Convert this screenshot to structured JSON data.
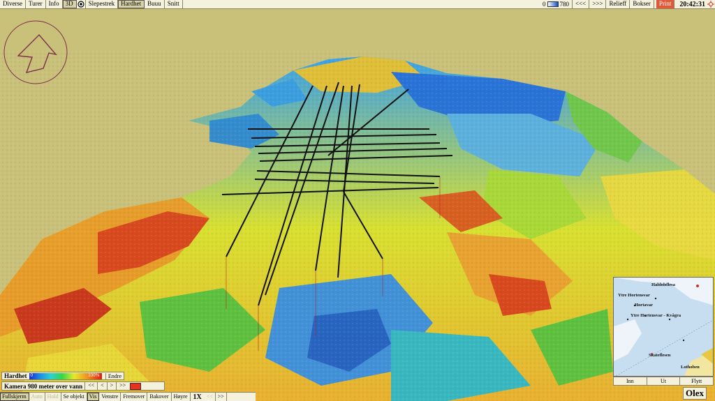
{
  "menu": {
    "items": [
      {
        "label": "Diverse",
        "active": false
      },
      {
        "label": "Turer",
        "active": false
      },
      {
        "label": "Info",
        "active": false
      },
      {
        "label": "3D",
        "active": true
      }
    ],
    "items2": [
      {
        "label": "Slepestrek",
        "active": false
      },
      {
        "label": "Hardhet",
        "active": true
      },
      {
        "label": "Buuu",
        "active": false
      },
      {
        "label": "Snitt",
        "active": false
      }
    ]
  },
  "depth": {
    "min": "0",
    "max": "780",
    "prev": "<<<",
    "next": ">>>"
  },
  "right_menu": {
    "relief": "Relieff",
    "bokser": "Bokser",
    "print": "Print"
  },
  "clock": "20:42:31",
  "hardness": {
    "label": "Hardhet",
    "min": "0",
    "max": "100%",
    "edit": "Endre"
  },
  "camera": {
    "label": "Kamera 980 meter over vann",
    "b1": "<<",
    "b2": "<",
    "b3": ">",
    "b4": ">>"
  },
  "bottom": {
    "items": [
      {
        "label": "Fullskjerm",
        "state": "active"
      },
      {
        "label": "Auto",
        "state": "disabled"
      },
      {
        "label": "Hold",
        "state": "disabled"
      },
      {
        "label": "Se objekt",
        "state": "normal"
      },
      {
        "label": "Vis",
        "state": "active"
      },
      {
        "label": "Venstre",
        "state": "normal"
      },
      {
        "label": "Fremover",
        "state": "normal"
      },
      {
        "label": "Bakover",
        "state": "normal"
      },
      {
        "label": "Høyre",
        "state": "normal"
      }
    ],
    "speed": "1X",
    "slow": "<<",
    "fast": ">>"
  },
  "minimap": {
    "labels": [
      "Ytre Hortensvar",
      "Hortavar",
      "Ytre Hortensvar - Kvågra",
      "Skateflesen",
      "Lothoben",
      "Haldolsflesa"
    ],
    "zoom_in": "Inn",
    "zoom_out": "Ut",
    "move": "Flytt"
  },
  "brand": "Olex",
  "colors": {
    "background": "#c9c07a",
    "hard_low": "#1a2ccc",
    "hard_mid": "#e8e82a",
    "hard_high": "#d81e14",
    "print": "#e05a3a"
  }
}
